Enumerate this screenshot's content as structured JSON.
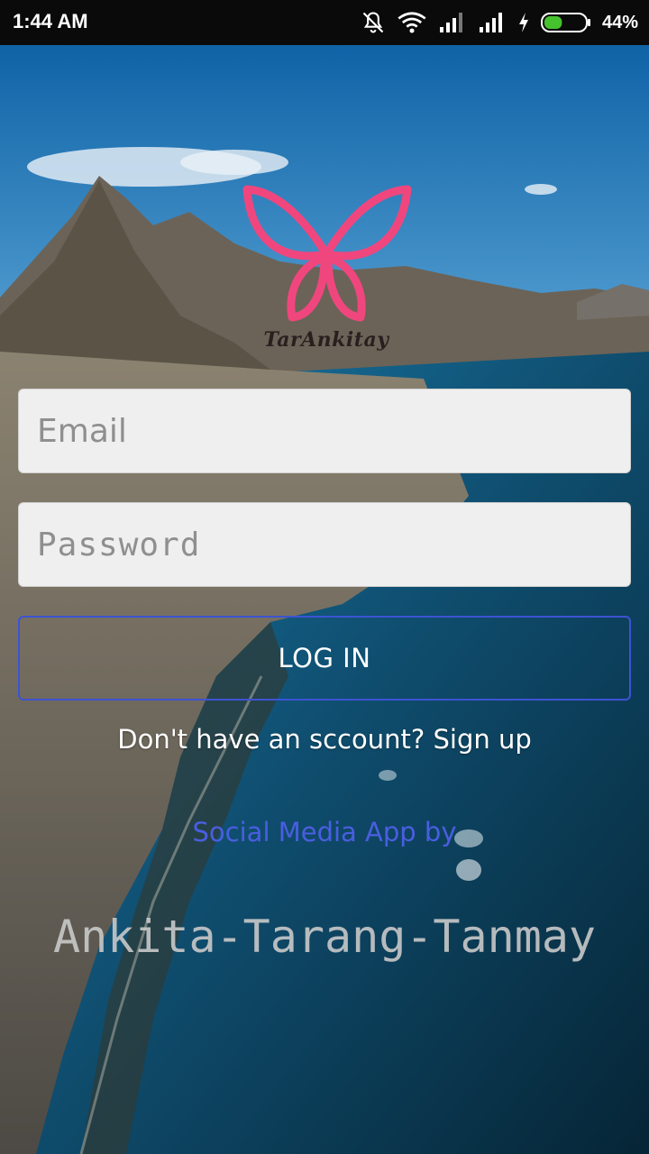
{
  "status_bar": {
    "time": "1:44 AM",
    "battery_percent": "44%",
    "battery_level": 0.44,
    "icons": [
      "mute-icon",
      "wifi-icon",
      "signal-icon",
      "signal-icon",
      "charging-icon",
      "battery-icon"
    ]
  },
  "logo": {
    "text": "TarAnkitay",
    "color": "#f0467e"
  },
  "login_form": {
    "email_placeholder": "Email",
    "password_placeholder": "Password",
    "login_label": "LOG IN",
    "signup_text": "Don't have an sccount? Sign up"
  },
  "footer": {
    "credits": "Social Media App by",
    "authors": "Ankita-Tarang-Tanmay"
  },
  "colors": {
    "accent": "#3d53d3",
    "credits": "#4a5ee0",
    "input_bg": "#efefef"
  }
}
